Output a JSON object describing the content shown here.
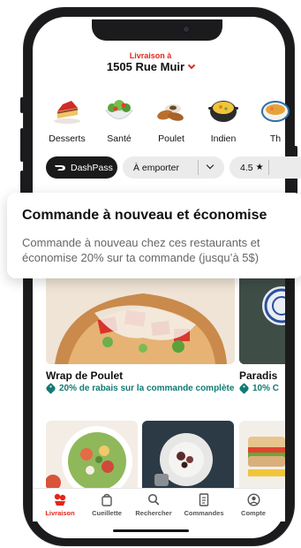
{
  "header": {
    "pre_label": "Livraison à",
    "address": "1505 Rue Muir"
  },
  "categories": [
    {
      "label": "Desserts",
      "icon": "cake-icon"
    },
    {
      "label": "Santé",
      "icon": "salad-icon"
    },
    {
      "label": "Poulet",
      "icon": "chicken-icon"
    },
    {
      "label": "Indien",
      "icon": "curry-pot-icon"
    },
    {
      "label": "Th",
      "icon": "thai-bowl-icon"
    }
  ],
  "filters": {
    "dashpass": "DashPass",
    "pickup": "À emporter",
    "rating": "4.5"
  },
  "promo": {
    "title": "Commande à nouveau et économise",
    "body": "Commande à nouveau chez ces restaurants et économise 20% sur ta commande (jusqu’à 5$)"
  },
  "restaurants": [
    {
      "name": "Wrap de Poulet",
      "deal": "20% de rabais sur la commande complète"
    },
    {
      "name": "Paradis",
      "deal": "10% C"
    }
  ],
  "bottom_nav": [
    {
      "label": "Livraison",
      "icon": "delivery-icon",
      "active": true
    },
    {
      "label": "Cueillette",
      "icon": "bag-icon",
      "active": false
    },
    {
      "label": "Rechercher",
      "icon": "search-icon",
      "active": false
    },
    {
      "label": "Commandes",
      "icon": "receipt-icon",
      "active": false
    },
    {
      "label": "Compte",
      "icon": "account-icon",
      "active": false
    }
  ],
  "colors": {
    "brand_red": "#e4261c",
    "deal_teal": "#117a73",
    "chip_dark": "#1a1a1a",
    "chip_light": "#ebebeb"
  }
}
